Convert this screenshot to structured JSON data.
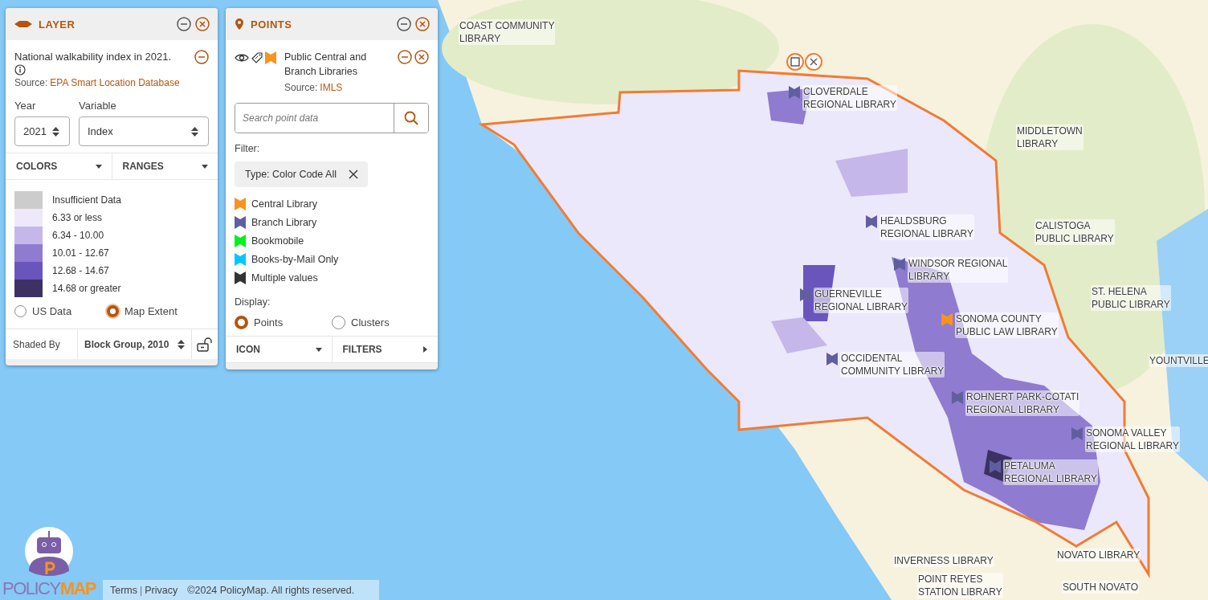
{
  "layer_panel": {
    "title": "LAYER",
    "layer_name": "National walkability index in 2021.",
    "source_label": "Source:",
    "source_link": "EPA Smart Location Database",
    "year_label": "Year",
    "year_value": "2021",
    "variable_label": "Variable",
    "variable_value": "Index",
    "tabs": [
      {
        "label": "COLORS"
      },
      {
        "label": "RANGES"
      }
    ],
    "legend": [
      {
        "label": "Insufficient Data",
        "color": "#cccccc"
      },
      {
        "label": "6.33 or less",
        "color": "#ede9fb"
      },
      {
        "label": "6.34 - 10.00",
        "color": "#c5b7ea"
      },
      {
        "label": "10.01 - 12.67",
        "color": "#8f7bd0"
      },
      {
        "label": "12.68 - 14.67",
        "color": "#6a55bd"
      },
      {
        "label": "14.68 or greater",
        "color": "#3d3163"
      }
    ],
    "extent_options": [
      {
        "label": "US Data",
        "selected": false
      },
      {
        "label": "Map Extent",
        "selected": true
      }
    ],
    "shaded_by_label": "Shaded By",
    "shaded_by_value": "Block Group, 2010"
  },
  "points_panel": {
    "title": "POINTS",
    "dataset_name": "Public Central and Branch Libraries",
    "source_label": "Source:",
    "source_link": "IMLS",
    "search": {
      "placeholder": "Search point data"
    },
    "filter_label": "Filter:",
    "filter_chip": "Type: Color Code All",
    "legend": [
      {
        "label": "Central Library",
        "color": "#f7931e"
      },
      {
        "label": "Branch Library",
        "color": "#5f5f9f"
      },
      {
        "label": "Bookmobile",
        "color": "#00f020"
      },
      {
        "label": "Books-by-Mail Only",
        "color": "#00c8ff"
      },
      {
        "label": "Multiple values",
        "color": "#333333"
      }
    ],
    "display_label": "Display:",
    "display_options": [
      {
        "label": "Points",
        "selected": true
      },
      {
        "label": "Clusters",
        "selected": false
      }
    ],
    "tabs": [
      {
        "label": "ICON",
        "kind": "dropdown"
      },
      {
        "label": "FILTERS",
        "kind": "next"
      }
    ]
  },
  "map_labels": [
    {
      "label": "COAST COMMUNITY\nLIBRARY",
      "kind": "plain"
    },
    {
      "label": "CLOVERDALE\nREGIONAL LIBRARY",
      "kind": "branch"
    },
    {
      "label": "MIDDLETOWN\nLIBRARY",
      "kind": "plain"
    },
    {
      "label": "HEALDSBURG\nREGIONAL LIBRARY",
      "kind": "branch"
    },
    {
      "label": "CALISTOGA\nPUBLIC LIBRARY",
      "kind": "plain"
    },
    {
      "label": "WINDSOR REGIONAL\nLIBRARY",
      "kind": "branch"
    },
    {
      "label": "GUERNEVILLE\nREGIONAL LIBRARY",
      "kind": "branch"
    },
    {
      "label": "ST. HELENA\nPUBLIC LIBRARY",
      "kind": "plain"
    },
    {
      "label": "SONOMA COUNTY\nPUBLIC LAW LIBRARY",
      "kind": "central"
    },
    {
      "label": "OCCIDENTAL\nCOMMUNITY LIBRARY",
      "kind": "branch"
    },
    {
      "label": "YOUNTVILLE",
      "kind": "plain"
    },
    {
      "label": "ROHNERT PARK-COTATI\nREGIONAL LIBRARY",
      "kind": "branch"
    },
    {
      "label": "SONOMA VALLEY\nREGIONAL LIBRARY",
      "kind": "branch"
    },
    {
      "label": "PETALUMA\nREGIONAL LIBRARY",
      "kind": "branch"
    },
    {
      "label": "INVERNESS LIBRARY",
      "kind": "plain"
    },
    {
      "label": "POINT REYES\nSTATION LIBRARY",
      "kind": "plain"
    },
    {
      "label": "NOVATO LIBRARY",
      "kind": "plain"
    },
    {
      "label": "SOUTH NOVATO",
      "kind": "plain"
    }
  ],
  "footer": {
    "logo_left": "POLICY",
    "logo_right": "MAP",
    "terms": "Terms",
    "separator": "|",
    "privacy": "Privacy",
    "copyright": "©2024 PolicyMap. All rights reserved."
  }
}
